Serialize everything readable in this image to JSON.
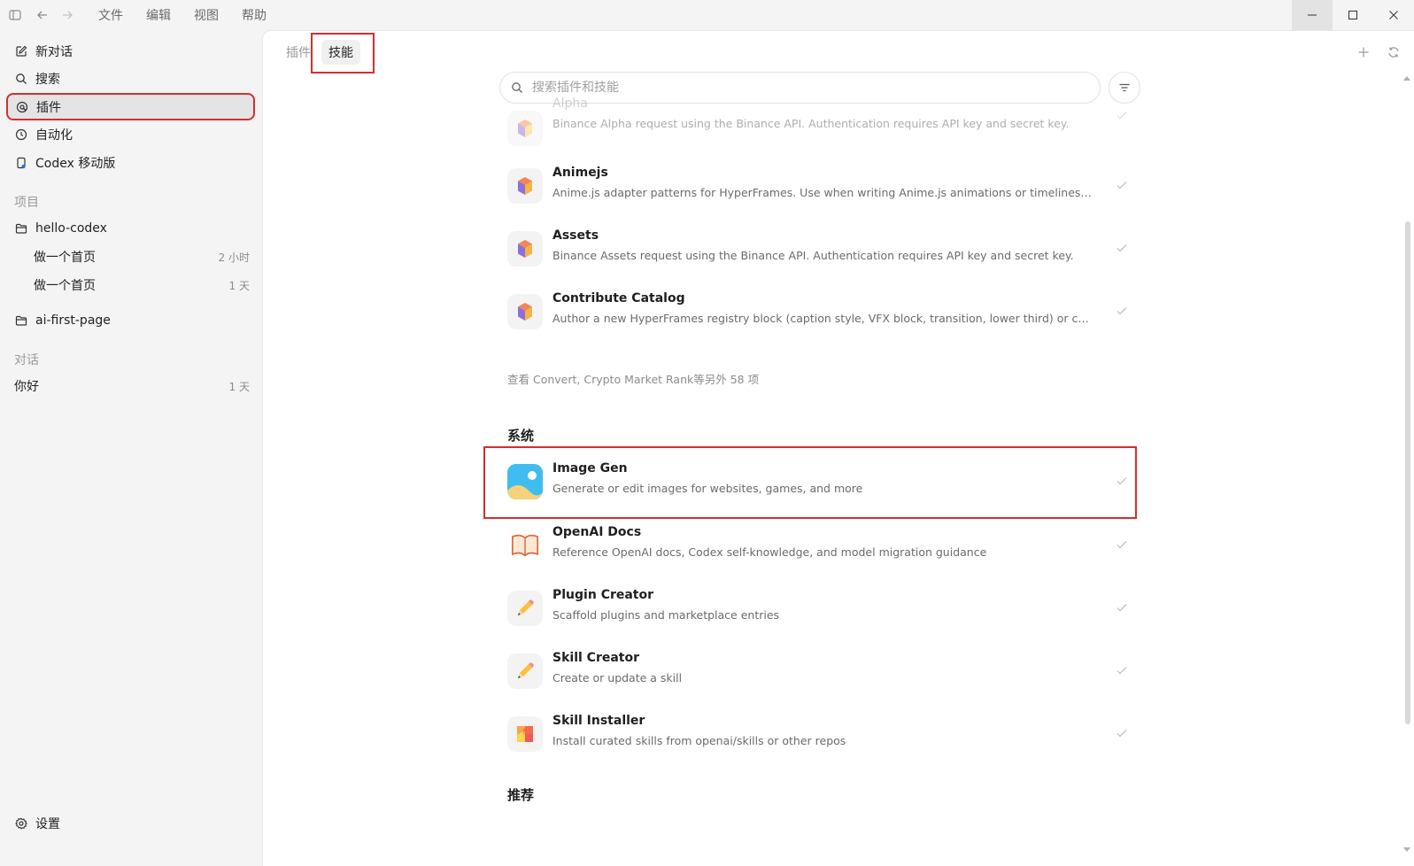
{
  "titlebar": {
    "menu": [
      "文件",
      "编辑",
      "视图",
      "帮助"
    ]
  },
  "sidebar": {
    "nav": [
      {
        "label": "新对话",
        "icon": "compose-icon"
      },
      {
        "label": "搜索",
        "icon": "search-icon"
      },
      {
        "label": "插件",
        "icon": "plugin-icon"
      },
      {
        "label": "自动化",
        "icon": "clock-icon"
      },
      {
        "label": "Codex 移动版",
        "icon": "mobile-icon"
      }
    ],
    "projects_heading": "项目",
    "projects": [
      {
        "name": "hello-codex",
        "threads": [
          {
            "label": "做一个首页",
            "time": "2 小时"
          },
          {
            "label": "做一个首页",
            "time": "1 天"
          }
        ]
      },
      {
        "name": "ai-first-page",
        "threads": []
      }
    ],
    "chats_heading": "对话",
    "chats": [
      {
        "label": "你好",
        "time": "1 天"
      }
    ],
    "settings_label": "设置"
  },
  "main": {
    "tabs": [
      {
        "label": "插件",
        "active": false
      },
      {
        "label": "技能",
        "active": true
      }
    ],
    "search_placeholder": "搜索插件和技能",
    "installed_skills": [
      {
        "title": "Alpha",
        "desc": "Binance Alpha request using the Binance API. Authentication requires API key and secret key.",
        "icon": "hexagon-icon"
      },
      {
        "title": "Animejs",
        "desc": "Anime.js adapter patterns for HyperFrames. Use when writing Anime.js animations or timelines inside...",
        "icon": "hexagon-icon"
      },
      {
        "title": "Assets",
        "desc": "Binance Assets request using the Binance API. Authentication requires API key and secret key.",
        "icon": "hexagon-icon"
      },
      {
        "title": "Contribute Catalog",
        "desc": "Author a new HyperFrames registry block (caption style, VFX block, transition, lower third) or component...",
        "icon": "hexagon-icon"
      }
    ],
    "more_link": "查看 Convert, Crypto Market Rank等另外 58 项",
    "system_heading": "系统",
    "system_skills": [
      {
        "title": "Image Gen",
        "desc": "Generate or edit images for websites, games, and more",
        "icon": "image-icon"
      },
      {
        "title": "OpenAI Docs",
        "desc": "Reference OpenAI docs, Codex self-knowledge, and model migration guidance",
        "icon": "book-icon"
      },
      {
        "title": "Plugin Creator",
        "desc": "Scaffold plugins and marketplace entries",
        "icon": "pencil-icon"
      },
      {
        "title": "Skill Creator",
        "desc": "Create or update a skill",
        "icon": "pencil-icon"
      },
      {
        "title": "Skill Installer",
        "desc": "Install curated skills from openai/skills or other repos",
        "icon": "puzzle-icon"
      }
    ],
    "recommended_heading": "推荐"
  },
  "colors": {
    "highlight": "#d32f2f",
    "sidebar_bg": "#f4f4f4",
    "main_bg": "#ffffff"
  }
}
